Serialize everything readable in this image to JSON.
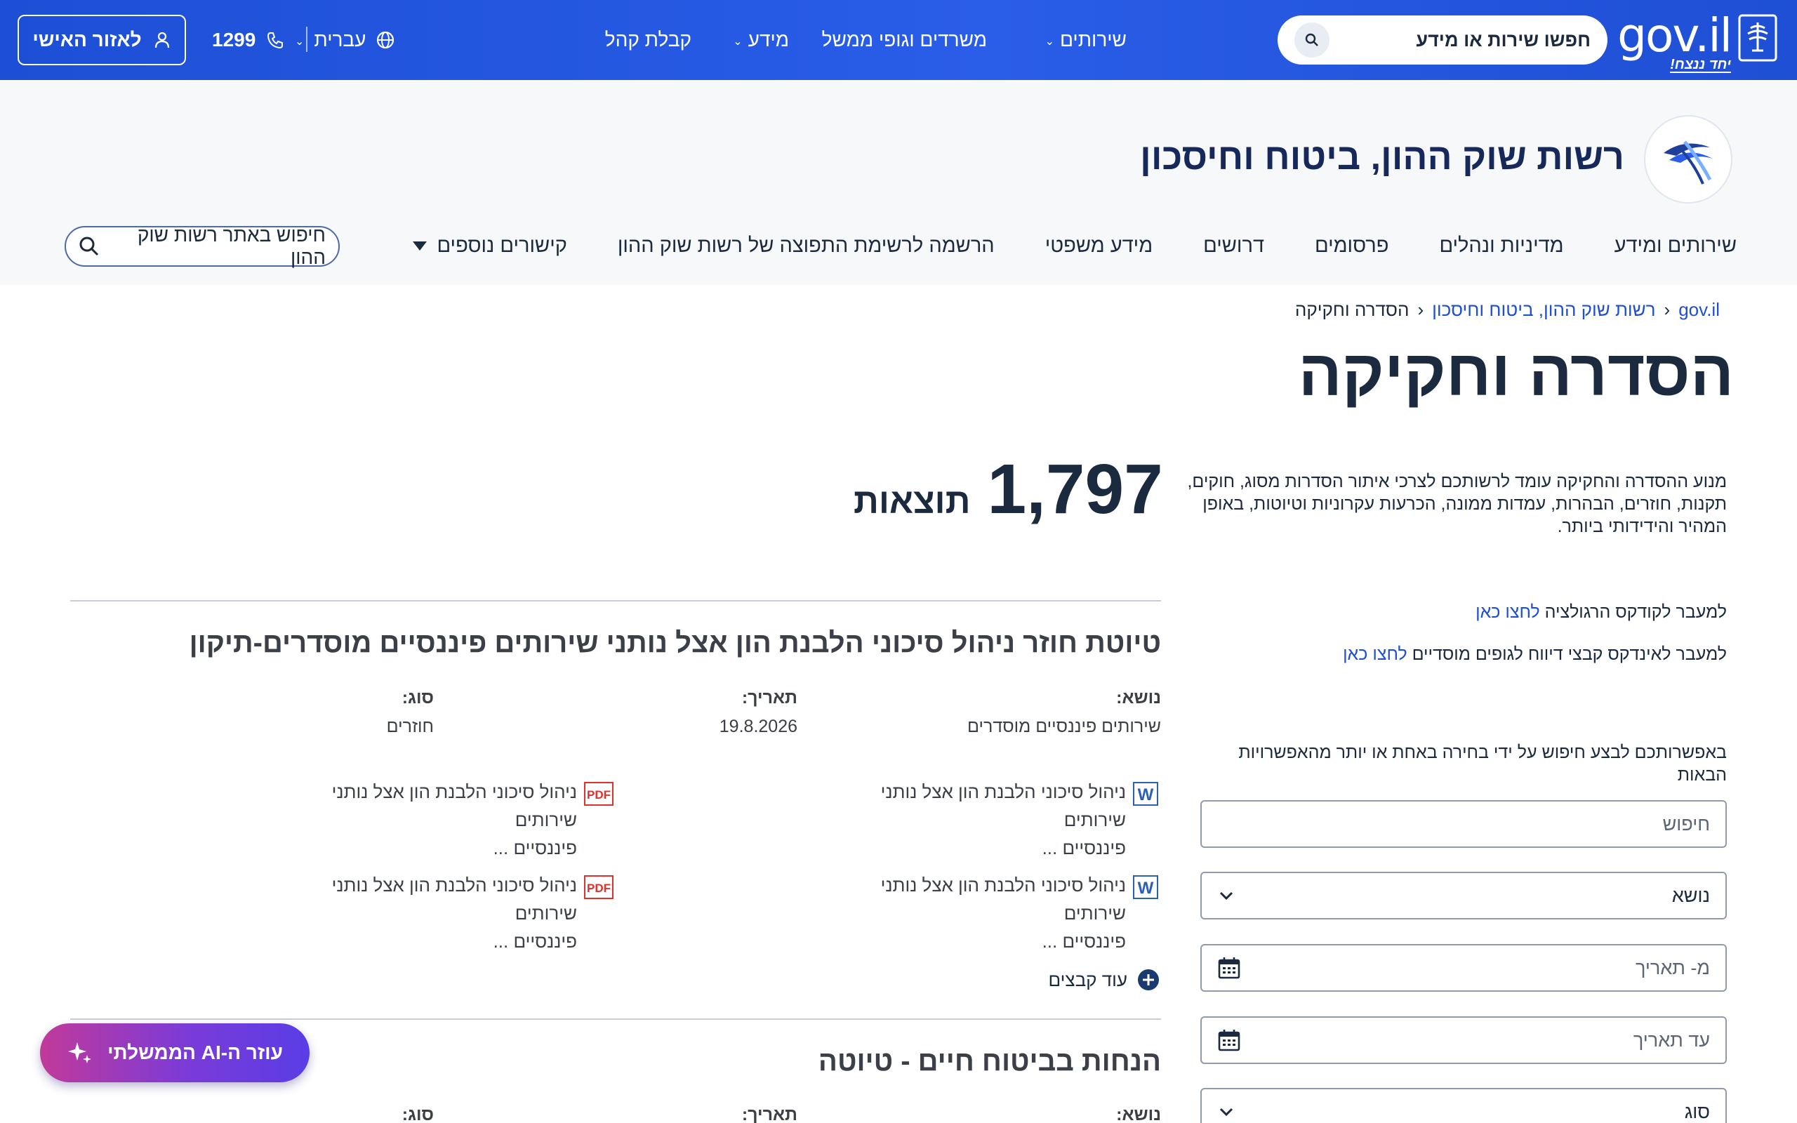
{
  "topbar": {
    "logo_text": "gov.il",
    "logo_sub": "יחד ננצח!",
    "search_placeholder": "חפשו שירות או מידע",
    "nav": [
      "שירותים",
      "משרדים וגופי ממשל",
      "מידע",
      "קבלת קהל"
    ],
    "language": "עברית",
    "phone": "1299",
    "personal_area": "לאזור האישי"
  },
  "site": {
    "title": "רשות שוק ההון, ביטוח וחיסכון",
    "nav": [
      "שירותים ומידע",
      "מדיניות ונהלים",
      "פרסומים",
      "דרושים",
      "מידע משפטי",
      "הרשמה לרשימת התפוצה של רשות שוק ההון",
      "קישורים נוספים"
    ],
    "search_placeholder": "חיפוש באתר רשות שוק ההון"
  },
  "breadcrumb": [
    "gov.il",
    "רשות שוק ההון, ביטוח וחיסכון",
    "הסדרה וחקיקה"
  ],
  "page_title": "הסדרה וחקיקה",
  "sidebar": {
    "intro": "מנוע ההסדרה והחקיקה עומד לרשותכם לצרכי איתור הסדרות מסוג, חוקים, תקנות, חוזרים, הבהרות, עמדות ממונה, הכרעות עקרוניות וטיוטות, באופן המהיר והידידותי ביותר.",
    "link1_text": "למעבר לקודקס הרגולציה ",
    "link1_anchor": "לחצו כאן",
    "link2_text": "למעבר לאינדקס קבצי דיווח לגופים מוסדיים ",
    "link2_anchor": "לחצו כאן",
    "filter_label": "באפשרותכם לבצע חיפוש על ידי בחירה באחת או יותר מהאפשרויות הבאות",
    "search_placeholder": "חיפוש",
    "topic_placeholder": "נושא",
    "from_date_placeholder": "מ- תאריך",
    "to_date_placeholder": "עד תאריך",
    "type_placeholder": "סוג"
  },
  "results": {
    "count": "1,797",
    "count_label": "תוצאות",
    "items": [
      {
        "title": "טיוטת חוזר ניהול סיכוני הלבנת הון אצל נותני שירותים פיננסיים מוסדרים-תיקון",
        "topic_label": "נושא:",
        "topic": "שירותים פיננסיים מוסדרים",
        "date_label": "תאריך:",
        "date": "19.8.2026",
        "type_label": "סוג:",
        "type": "חוזרים",
        "files": [
          {
            "icon": "word-icon",
            "name_line1": "ניהול סיכוני הלבנת הון אצל נותני שירותים",
            "name_line2": "פיננסיים ..."
          },
          {
            "icon": "pdf-icon",
            "name_line1": "ניהול סיכוני הלבנת הון אצל נותני שירותים",
            "name_line2": "פיננסיים ..."
          },
          {
            "icon": "word-icon",
            "name_line1": "ניהול סיכוני הלבנת הון אצל נותני שירותים",
            "name_line2": "פיננסיים ..."
          },
          {
            "icon": "pdf-icon",
            "name_line1": "ניהול סיכוני הלבנת הון אצל נותני שירותים",
            "name_line2": "פיננסיים ..."
          }
        ],
        "more_files": "עוד קבצים"
      },
      {
        "title": "הנחות בביטוח חיים - טיוטה",
        "topic_label": "נושא:",
        "date_label": "תאריך:",
        "type_label": "סוג:"
      }
    ]
  },
  "ai_helper": {
    "label": "עוזר ה-AI הממשלתי"
  },
  "colors": {
    "brand_blue": "#1e4fd4",
    "title_navy": "#17295a",
    "pdf_red": "#e0322b",
    "word_blue": "#2b5fb8"
  }
}
